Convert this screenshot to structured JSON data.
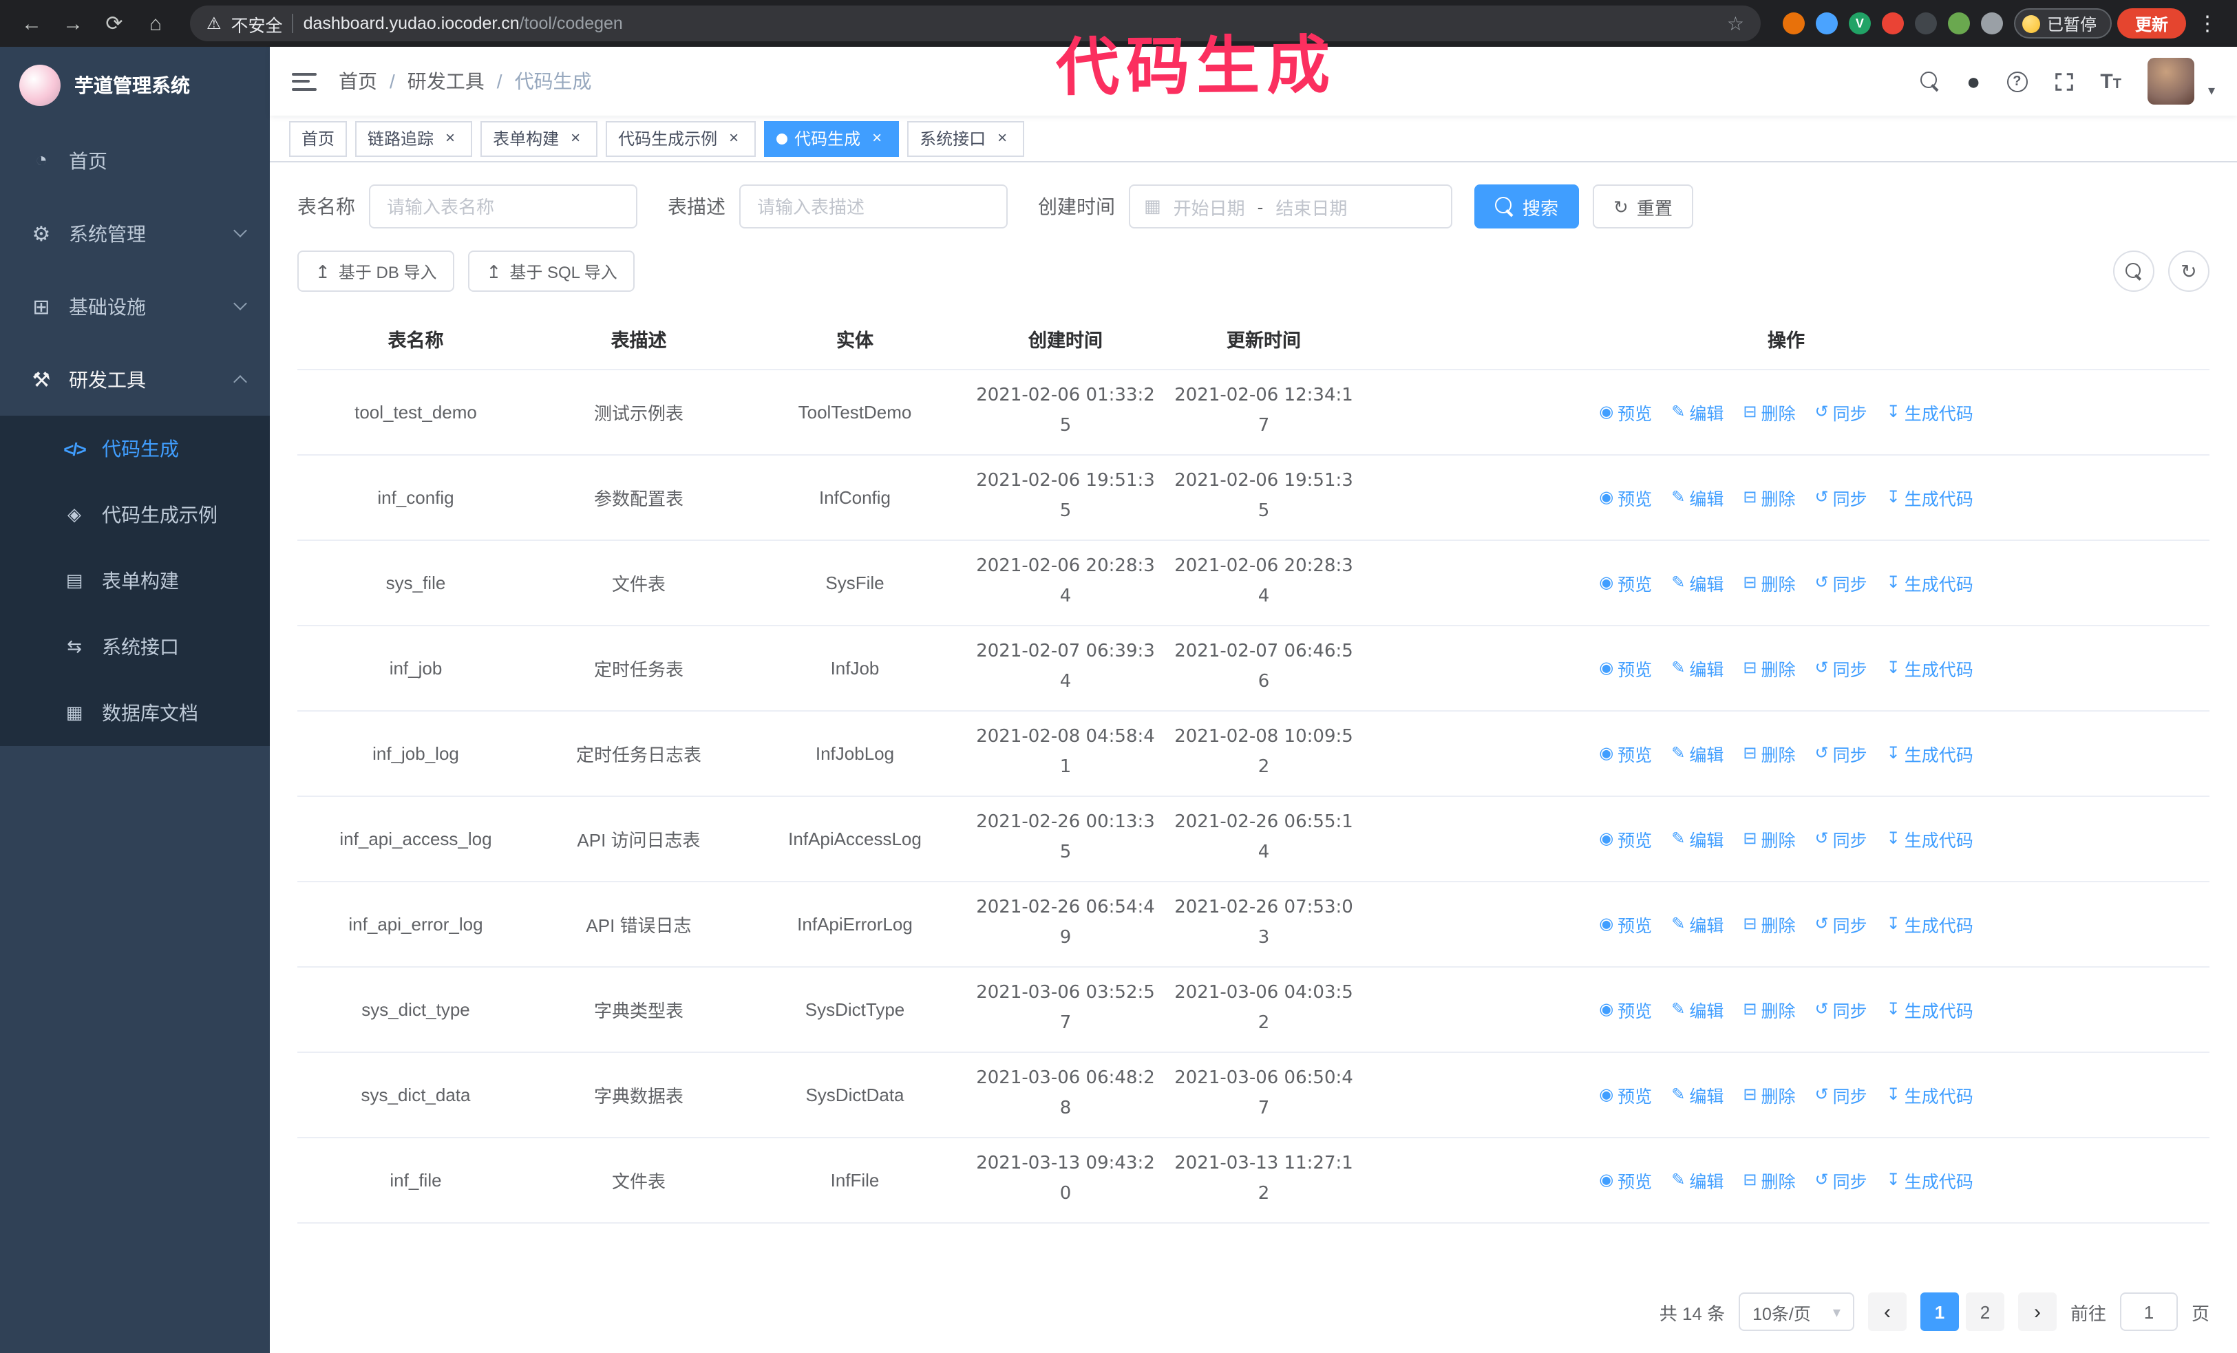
{
  "colors": {
    "accent": "#409EFF",
    "sidebar_bg": "#304156",
    "submenu_bg": "#1f2d3d",
    "annotation": "#fb2f5f",
    "update_button": "#e5452f",
    "chrome_bg": "#202124"
  },
  "annotation": {
    "text": "代码生成"
  },
  "browser": {
    "security_label": "不安全",
    "url_host": "dashboard.yudao.iocoder.cn",
    "url_path": "/tool/codegen",
    "paused_badge": "已暂停",
    "update_button": "更新",
    "extensions": [
      {
        "name": "extension-orange",
        "color": "#e8710a"
      },
      {
        "name": "extension-blue",
        "color": "#4aa3ff"
      },
      {
        "name": "extension-green-v",
        "color": "#21a366",
        "text": "V"
      },
      {
        "name": "extension-grid",
        "color": "#ea4335"
      },
      {
        "name": "extension-dark",
        "color": "#41464b"
      },
      {
        "name": "extension-leaf",
        "color": "#6aa84f"
      },
      {
        "name": "extension-puzzle",
        "color": "#9aa0a6"
      }
    ]
  },
  "icons": {
    "back": "←",
    "forward": "→",
    "reload": "⟳",
    "home": "⌂",
    "warning": "⚠",
    "star": "☆",
    "kebab": "⋮",
    "dashboard": "◔",
    "gear": "⚙",
    "monitor": "⊞",
    "tools": "⚒",
    "code": "</>",
    "badge": "◈",
    "form": "▤",
    "api": "⇆",
    "db": "▦",
    "github": "●",
    "help": "?",
    "font_big": "T",
    "font_small": "T",
    "caret-down": "▾",
    "calendar": "▦",
    "refresh": "↻",
    "upload": "↥",
    "eye": "◉",
    "edit": "✎",
    "delete": "⊟",
    "sync": "↺",
    "download": "↧"
  },
  "sidebar": {
    "logo_title": "芋道管理系统",
    "items": [
      {
        "key": "home",
        "label": "首页",
        "icon": "dashboard"
      },
      {
        "key": "system",
        "label": "系统管理",
        "icon": "gear",
        "caret": "down"
      },
      {
        "key": "infra",
        "label": "基础设施",
        "icon": "monitor",
        "caret": "down"
      },
      {
        "key": "devtools",
        "label": "研发工具",
        "icon": "tools",
        "caret": "up",
        "open": true
      }
    ],
    "submenu": [
      {
        "key": "codegen",
        "label": "代码生成",
        "icon": "code",
        "active": true
      },
      {
        "key": "codegen-demo",
        "label": "代码生成示例",
        "icon": "badge"
      },
      {
        "key": "form-builder",
        "label": "表单构建",
        "icon": "form"
      },
      {
        "key": "api",
        "label": "系统接口",
        "icon": "api"
      },
      {
        "key": "db-doc",
        "label": "数据库文档",
        "icon": "db"
      }
    ]
  },
  "header": {
    "breadcrumb": [
      "首页",
      "研发工具",
      "代码生成"
    ],
    "separator": "/"
  },
  "tabs": [
    {
      "key": "home",
      "label": "首页",
      "closable": false
    },
    {
      "key": "tracer",
      "label": "链路追踪",
      "closable": true
    },
    {
      "key": "form-builder",
      "label": "表单构建",
      "closable": true
    },
    {
      "key": "codegen-demo",
      "label": "代码生成示例",
      "closable": true
    },
    {
      "key": "codegen",
      "label": "代码生成",
      "closable": true,
      "active": true
    },
    {
      "key": "api",
      "label": "系统接口",
      "closable": true
    }
  ],
  "filters": {
    "table_name_label": "表名称",
    "table_name_placeholder": "请输入表名称",
    "table_desc_label": "表描述",
    "table_desc_placeholder": "请输入表描述",
    "create_time_label": "创建时间",
    "date_start_placeholder": "开始日期",
    "date_separator": "-",
    "date_end_placeholder": "结束日期",
    "search_button": "搜索",
    "reset_button": "重置"
  },
  "toolbar": {
    "import_db": "基于 DB 导入",
    "import_sql": "基于 SQL 导入"
  },
  "table": {
    "columns": [
      "表名称",
      "表描述",
      "实体",
      "创建时间",
      "更新时间",
      "操作"
    ],
    "actions": [
      {
        "key": "preview",
        "label": "预览",
        "icon": "eye"
      },
      {
        "key": "edit",
        "label": "编辑",
        "icon": "edit"
      },
      {
        "key": "delete",
        "label": "删除",
        "icon": "delete"
      },
      {
        "key": "sync",
        "label": "同步",
        "icon": "sync"
      },
      {
        "key": "generate",
        "label": "生成代码",
        "icon": "download"
      }
    ],
    "rows": [
      {
        "name": "tool_test_demo",
        "desc": "测试示例表",
        "entity": "ToolTestDemo",
        "created": "2021-02-06 01:33:25",
        "updated": "2021-02-06 12:34:17"
      },
      {
        "name": "inf_config",
        "desc": "参数配置表",
        "entity": "InfConfig",
        "created": "2021-02-06 19:51:35",
        "updated": "2021-02-06 19:51:35"
      },
      {
        "name": "sys_file",
        "desc": "文件表",
        "entity": "SysFile",
        "created": "2021-02-06 20:28:34",
        "updated": "2021-02-06 20:28:34"
      },
      {
        "name": "inf_job",
        "desc": "定时任务表",
        "entity": "InfJob",
        "created": "2021-02-07 06:39:34",
        "updated": "2021-02-07 06:46:56"
      },
      {
        "name": "inf_job_log",
        "desc": "定时任务日志表",
        "entity": "InfJobLog",
        "created": "2021-02-08 04:58:41",
        "updated": "2021-02-08 10:09:52"
      },
      {
        "name": "inf_api_access_log",
        "desc": "API 访问日志表",
        "entity": "InfApiAccessLog",
        "created": "2021-02-26 00:13:35",
        "updated": "2021-02-26 06:55:14"
      },
      {
        "name": "inf_api_error_log",
        "desc": "API 错误日志",
        "entity": "InfApiErrorLog",
        "created": "2021-02-26 06:54:49",
        "updated": "2021-02-26 07:53:03"
      },
      {
        "name": "sys_dict_type",
        "desc": "字典类型表",
        "entity": "SysDictType",
        "created": "2021-03-06 03:52:57",
        "updated": "2021-03-06 04:03:52"
      },
      {
        "name": "sys_dict_data",
        "desc": "字典数据表",
        "entity": "SysDictData",
        "created": "2021-03-06 06:48:28",
        "updated": "2021-03-06 06:50:47"
      },
      {
        "name": "inf_file",
        "desc": "文件表",
        "entity": "InfFile",
        "created": "2021-03-13 09:43:20",
        "updated": "2021-03-13 11:27:12"
      }
    ]
  },
  "pagination": {
    "total": "共 14 条",
    "page_size": "10条/页",
    "pages": [
      "1",
      "2"
    ],
    "active_page": "1",
    "prev": "‹",
    "next": "›",
    "goto_label": "前往",
    "goto_value": "1",
    "goto_suffix": "页"
  }
}
